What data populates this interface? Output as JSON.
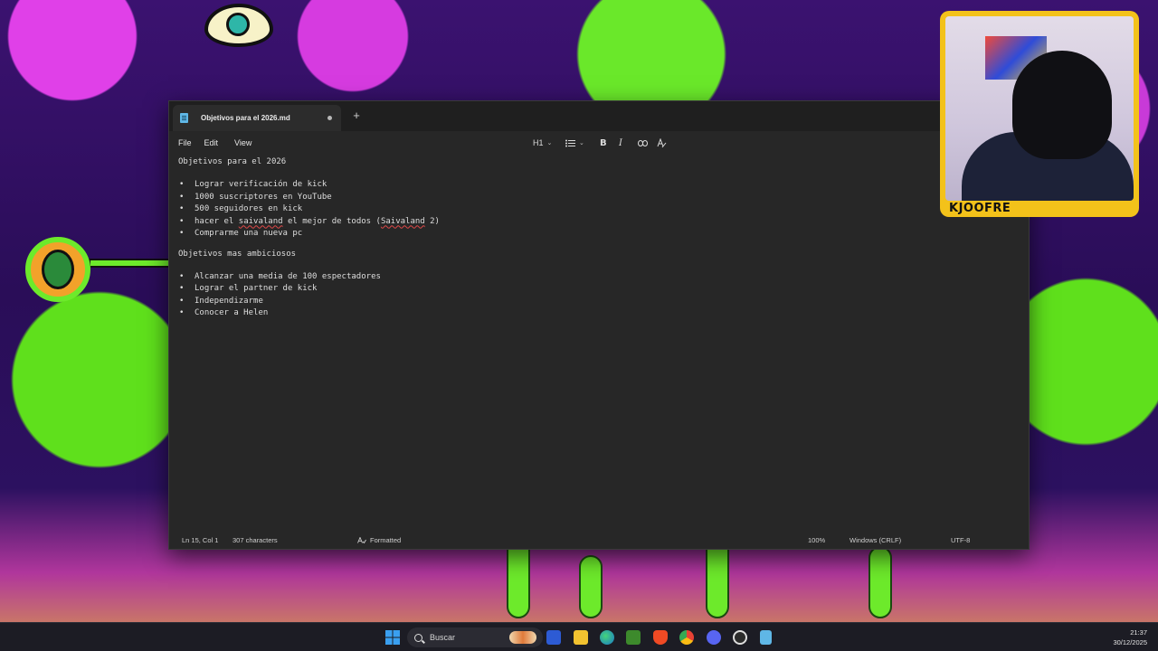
{
  "window": {
    "tab_title": "Objetivos para el 2026.md",
    "new_tab": "+"
  },
  "menu": [
    "File",
    "Edit",
    "View"
  ],
  "format_toolbar": {
    "heading": "H1",
    "bold": "B",
    "italic": "I",
    "icons": [
      "heading-dropdown",
      "list-icon",
      "bold-icon",
      "italic-icon",
      "link-icon",
      "clear-formatting-icon"
    ]
  },
  "document": {
    "heading1": "Objetivos para el 2026",
    "list1": [
      "Lograr verificación de kick",
      "1000 suscriptores en YouTube",
      "500 seguidores en kick",
      "hacer el saivaland el mejor de todos (Saivaland 2)",
      "Comprarme una nueva pc"
    ],
    "heading2": "Objetivos mas ambiciosos",
    "list2": [
      "Alcanzar una media de 100 espectadores",
      "Lograr el partner de kick",
      "Independizarme",
      "Conocer a Helen"
    ]
  },
  "status": {
    "position": "Ln 15, Col 1",
    "characters": "307 characters",
    "mode": "Formatted",
    "zoom": "100%",
    "line_endings": "Windows (CRLF)",
    "encoding": "UTF-8"
  },
  "webcam": {
    "name": "KJOOFRE"
  },
  "taskbar": {
    "search_placeholder": "Buscar",
    "time": "21:37",
    "date": "30/12/2025",
    "apps": [
      "windows-start",
      "search",
      "store",
      "file-explorer",
      "edge",
      "minecraft",
      "brave",
      "chrome",
      "discord",
      "obs",
      "notepad"
    ]
  },
  "colors": {
    "window_bg": "#272727",
    "titlebar_bg": "#1f1f1f",
    "text": "#dedede",
    "accent_yellow": "#f3c21a",
    "spell_error": "#e04848"
  }
}
